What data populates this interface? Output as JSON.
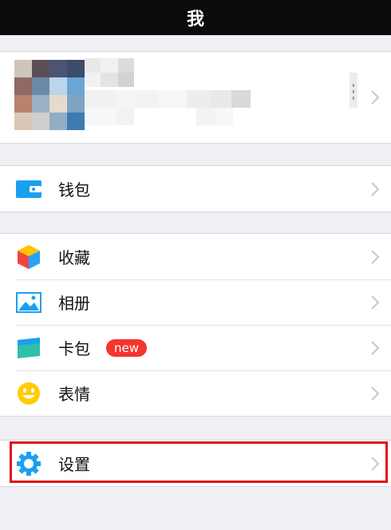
{
  "header": {
    "title": "我"
  },
  "menu": {
    "wallet": "钱包",
    "favorites": "收藏",
    "album": "相册",
    "cards": "卡包",
    "cards_badge": "new",
    "stickers": "表情",
    "settings": "设置"
  },
  "colors": {
    "nav_bg": "#0b0b0b",
    "page_bg": "#efeff4",
    "accent_blue": "#1aa0f0",
    "badge_red": "#f43530",
    "highlight_red": "#e00f17"
  }
}
